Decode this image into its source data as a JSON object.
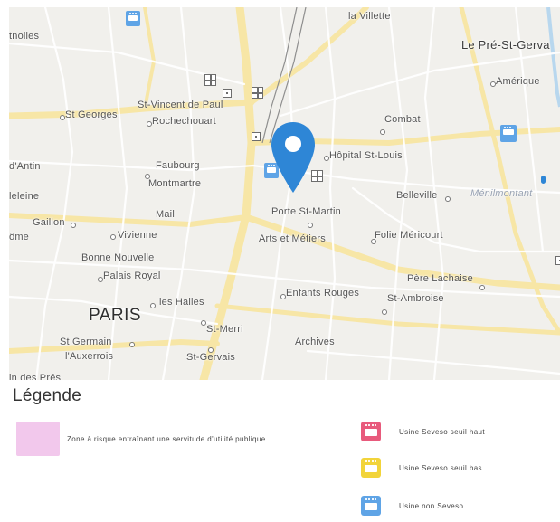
{
  "map": {
    "places": [
      {
        "key": "la-villette",
        "label": "la Villette",
        "cls": ""
      },
      {
        "key": "batignolles",
        "label": "tnolles",
        "cls": ""
      },
      {
        "key": "pre-st-gervais",
        "label": "Le Pré-St-Gerva",
        "cls": "mid"
      },
      {
        "key": "amerique",
        "label": "Amérique",
        "cls": ""
      },
      {
        "key": "st-georges",
        "label": "St Georges",
        "cls": ""
      },
      {
        "key": "st-vincent-de-paul",
        "label": "St-Vincent de Paul",
        "cls": ""
      },
      {
        "key": "rochechouart",
        "label": "Rochechouart",
        "cls": ""
      },
      {
        "key": "combat",
        "label": "Combat",
        "cls": ""
      },
      {
        "key": "hopital-st-louis",
        "label": "Hôpital St-Louis",
        "cls": ""
      },
      {
        "key": "chaussee-dantin",
        "label": "d'Antin",
        "cls": ""
      },
      {
        "key": "faubourg",
        "label": "Faubourg",
        "cls": ""
      },
      {
        "key": "montmartre",
        "label": "Montmartre",
        "cls": ""
      },
      {
        "key": "madeleine",
        "label": "leleine",
        "cls": ""
      },
      {
        "key": "belleville",
        "label": "Belleville",
        "cls": ""
      },
      {
        "key": "menilmontant",
        "label": "Ménilmontant",
        "cls": "faint"
      },
      {
        "key": "mail",
        "label": "Mail",
        "cls": ""
      },
      {
        "key": "porte-st-martin",
        "label": "Porte St-Martin",
        "cls": ""
      },
      {
        "key": "gaillon",
        "label": "Gaillon",
        "cls": ""
      },
      {
        "key": "vivienne",
        "label": "Vivienne",
        "cls": ""
      },
      {
        "key": "opera",
        "label": "ôme",
        "cls": ""
      },
      {
        "key": "arts-et-metiers",
        "label": "Arts et Métiers",
        "cls": ""
      },
      {
        "key": "folie-mericourt",
        "label": "Folie Méricourt",
        "cls": ""
      },
      {
        "key": "bonne-nouvelle",
        "label": "Bonne Nouvelle",
        "cls": ""
      },
      {
        "key": "palais-royal",
        "label": "Palais Royal",
        "cls": ""
      },
      {
        "key": "pere-lachaise",
        "label": "Père Lachaise",
        "cls": ""
      },
      {
        "key": "enfants-rouges",
        "label": "Enfants Rouges",
        "cls": ""
      },
      {
        "key": "st-ambroise",
        "label": "St-Ambroise",
        "cls": ""
      },
      {
        "key": "les-halles",
        "label": "les Halles",
        "cls": ""
      },
      {
        "key": "paris",
        "label": "PARIS",
        "cls": "big"
      },
      {
        "key": "st-merri",
        "label": "St-Merri",
        "cls": ""
      },
      {
        "key": "st-germain",
        "label": "St Germain",
        "cls": ""
      },
      {
        "key": "lauxerrois",
        "label": "l'Auxerrois",
        "cls": ""
      },
      {
        "key": "archives",
        "label": "Archives",
        "cls": ""
      },
      {
        "key": "st-gervais",
        "label": "St-Gervais",
        "cls": ""
      },
      {
        "key": "des-pres",
        "label": "in des Prés",
        "cls": ""
      }
    ]
  },
  "legend": {
    "title": "Légende",
    "zone_label": "Zone à risque entraînant une servitude d'utilité publique",
    "seveso_high_label": "Usine Seveso seuil haut",
    "seveso_low_label": "Usine Seveso seuil bas",
    "non_seveso_label": "Usine non Seveso",
    "colors": {
      "zone": "#f2c8ec",
      "seveso_high": "#e85a7c",
      "seveso_low": "#f2d43a",
      "non_seveso": "#5fa4e6",
      "pin": "#2e86d6"
    }
  }
}
